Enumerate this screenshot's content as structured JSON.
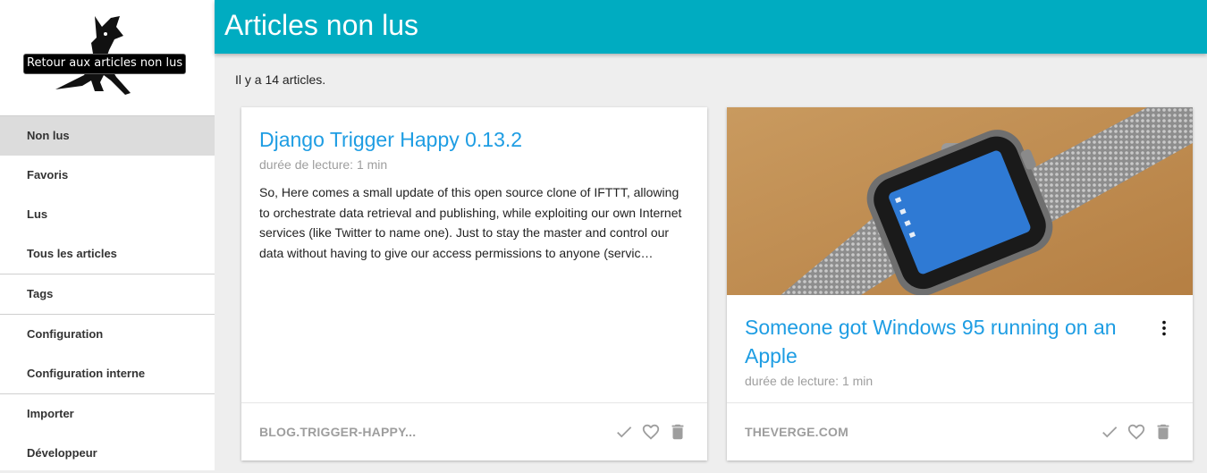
{
  "sidebar": {
    "tooltip": "Retour aux articles non lus",
    "groups": [
      [
        {
          "label": "Non lus",
          "active": true
        },
        {
          "label": "Favoris"
        },
        {
          "label": "Lus"
        },
        {
          "label": "Tous les articles"
        }
      ],
      [
        {
          "label": "Tags"
        }
      ],
      [
        {
          "label": "Configuration"
        },
        {
          "label": "Configuration interne"
        }
      ],
      [
        {
          "label": "Importer"
        },
        {
          "label": "Développeur"
        }
      ]
    ]
  },
  "header": {
    "title": "Articles non lus"
  },
  "main": {
    "count_text": "Il y a 14 articles.",
    "articles": [
      {
        "title": "Django Trigger Happy 0.13.2",
        "reading_time": "durée de lecture: 1 min",
        "excerpt": "So, Here comes a small update of this open source clone of IFTTT, allowing to orchestrate data retrieval and publishing, while exploiting our own Internet services (like Twitter to name one). Just to stay the master and control our data without having to give our access permissions to anyone (servic…",
        "source": "BLOG.TRIGGER-HAPPY..."
      },
      {
        "title": "Someone got Windows 95 running on an Apple",
        "reading_time": "durée de lecture: 1 min",
        "source": "THEVERGE.COM",
        "image": "apple-watch-windows95-photo"
      }
    ]
  },
  "icons": [
    "logo-icon",
    "check-icon",
    "heart-icon",
    "trash-icon",
    "more-vert-icon"
  ],
  "colors": {
    "accent": "#00acc1",
    "link": "#1e9de3"
  }
}
